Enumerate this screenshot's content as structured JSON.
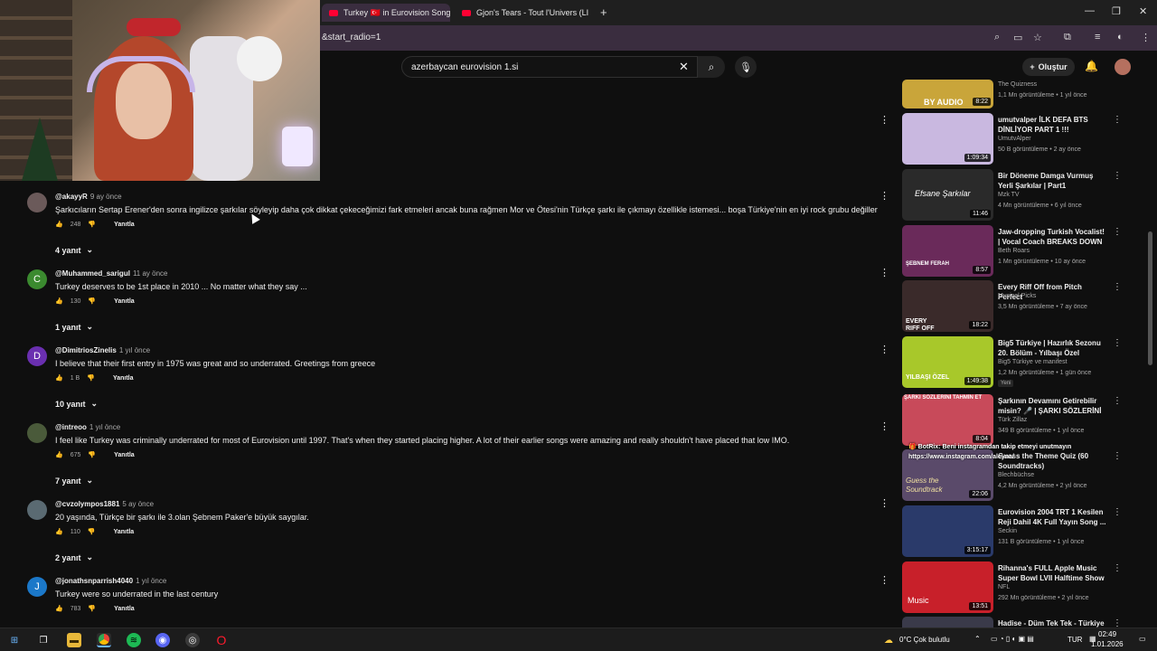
{
  "browser": {
    "tabs": [
      {
        "title": "Turkey 🇹🇷 in Eurovision Song C",
        "active": true
      },
      {
        "title": "Gjon's Tears - Tout l'Univers (LI",
        "active": false
      }
    ],
    "url": "&start_radio=1"
  },
  "header": {
    "search_value": "azerbaycan eurovision 1.si",
    "create_label": "Oluştur"
  },
  "comments": [
    {
      "author": "@akayyR",
      "time": "9 ay önce",
      "text": "Şarkıcıların Sertap Erener'den sonra ingilizce şarkılar söyleyip daha çok dikkat çekeceğimizi fark etmeleri ancak buna rağmen Mor ve Ötesi'nin Türkçe şarkı ile çıkmayı özellikle istemesi... boşa Türkiye'nin en iyi rock grubu değiller",
      "likes": "248",
      "reply": "Yanıtla",
      "replies": "4 yanıt",
      "avatar_letter": "",
      "avatar_color": "#6b5a5a"
    },
    {
      "author": "@Muhammed_sarigul",
      "time": "11 ay önce",
      "text": "Turkey deserves to be 1st place in 2010 ... No matter what they say ...",
      "likes": "130",
      "reply": "Yanıtla",
      "replies": "1 yanıt",
      "avatar_letter": "C",
      "avatar_color": "#3b8a2f"
    },
    {
      "author": "@DimitriosZinelis",
      "time": "1 yıl önce",
      "text": "I believe that their first entry in 1975 was great and so underrated.  Greetings from greece",
      "likes": "1 B",
      "reply": "Yanıtla",
      "replies": "10 yanıt",
      "avatar_letter": "D",
      "avatar_color": "#6a2fb0"
    },
    {
      "author": "@intreoo",
      "time": "1 yıl önce",
      "text": "I feel like Turkey was criminally underrated for most of Eurovision until 1997. That's when they started placing higher. A lot of their earlier songs were amazing and really shouldn't have placed that low IMO.",
      "likes": "675",
      "reply": "Yanıtla",
      "replies": "7 yanıt",
      "avatar_letter": "",
      "avatar_color": "#4a5a3a"
    },
    {
      "author": "@cvzolympos1881",
      "time": "5 ay önce",
      "text": "20 yaşında, Türkçe bir şarkı ile 3.olan Şebnem Paker'e büyük saygılar.",
      "likes": "110",
      "reply": "Yanıtla",
      "replies": "2 yanıt",
      "avatar_letter": "",
      "avatar_color": "#5a6a72"
    },
    {
      "author": "@jonathsnparrish4040",
      "time": "1 yıl önce",
      "text": "Turkey were so underrated in the last century",
      "likes": "783",
      "reply": "Yanıtla",
      "replies": "",
      "avatar_letter": "J",
      "avatar_color": "#1b78c9"
    }
  ],
  "sidebar": [
    {
      "title": "",
      "channel": "The Quizness",
      "meta": "1,1 Mn görüntüleme • 1 yıl önce",
      "duration": "8:22",
      "badge": "",
      "thumb_color": "#c9a53a",
      "thumb_text": "BY AUDIO"
    },
    {
      "title": "umutvalper İLK DEFA BTS DİNLİYOR PART 1 !!!",
      "channel": "UmutvAlper",
      "meta": "50 B görüntüleme • 2 ay önce",
      "duration": "1:09:34",
      "badge": "",
      "thumb_color": "#c9b8e0",
      "thumb_text": ""
    },
    {
      "title": "Bir Döneme Damga Vurmuş Yerli Şarkılar | Part1",
      "channel": "Mzk TV",
      "meta": "4 Mn görüntüleme • 6 yıl önce",
      "duration": "11:46",
      "badge": "",
      "thumb_color": "#2a2a2a",
      "thumb_text": "Efsane Şarkılar"
    },
    {
      "title": "Jaw-dropping Turkish Vocalist! | Vocal Coach BREAKS DOWN ...",
      "channel": "Beth Roars",
      "meta": "1 Mn görüntüleme • 10 ay önce",
      "duration": "8:57",
      "badge": "",
      "thumb_color": "#6a2a5a",
      "thumb_text": "ŞEBNEM FERAH"
    },
    {
      "title": "Every Riff Off from Pitch Perfect",
      "channel": "Musical Picks",
      "meta": "3,5 Mn görüntüleme • 7 ay önce",
      "duration": "18:22",
      "badge": "",
      "thumb_color": "#3a2a2a",
      "thumb_text": "EVERY RIFF OFF"
    },
    {
      "title": "Big5 Türkiye | Hazırlık Sezonu 20. Bölüm - Yılbaşı Özel",
      "channel": "Big5 Türkiye ve manifest",
      "meta": "1,2 Mn görüntüleme • 1 gün önce",
      "duration": "1:49:38",
      "badge": "Yeni",
      "thumb_color": "#a8c82a",
      "thumb_text": "YILBAŞI ÖZEL"
    },
    {
      "title": "Şarkının Devamını Getirebilir misin? 🎤 | ŞARKI SÖZLERİNİ ...",
      "channel": "Türk Zillaz",
      "meta": "349 B görüntüleme • 1 yıl önce",
      "duration": "8:04",
      "badge": "",
      "thumb_color": "#c84a5a",
      "thumb_text": "ŞARKI SÖZLERİNİ TAHMİN ET"
    },
    {
      "title": "Guess the Theme Quiz (60 Soundtracks)",
      "channel": "Blechbüchse",
      "meta": "4,2 Mn görüntüleme • 2 yıl önce",
      "duration": "22:06",
      "badge": "",
      "thumb_color": "#5a4a6a",
      "thumb_text": "Guess the Soundtrack"
    },
    {
      "title": "Eurovision 2004 TRT 1 Kesilen Reji Dahil 4K Full Yayın Song ...",
      "channel": "Seckin",
      "meta": "131 B görüntüleme • 1 yıl önce",
      "duration": "3:15:17",
      "badge": "",
      "thumb_color": "#2a3a6a",
      "thumb_text": ""
    },
    {
      "title": "Rihanna's FULL Apple Music Super Bowl LVII Halftime Show",
      "channel": "NFL",
      "meta": "292 Mn görüntüleme • 2 yıl önce",
      "duration": "13:51",
      "badge": "",
      "thumb_color": "#c8202a",
      "thumb_text": "Music"
    },
    {
      "title": "Hadise - Düm Tek Tek - Türkiye",
      "channel": "",
      "meta": "",
      "duration": "",
      "badge": "",
      "thumb_color": "#3a3a4a",
      "thumb_text": ""
    }
  ],
  "overlay": {
    "line1": "🎁 BotRix: Beni instagramdan takip etmeyi unutmayın",
    "line2": "https://www.instagram.com/aleyna/"
  },
  "taskbar": {
    "weather": "0°C  Çok bulutlu",
    "language": "TUR",
    "time": "02:49",
    "date": "1.01.2026"
  }
}
